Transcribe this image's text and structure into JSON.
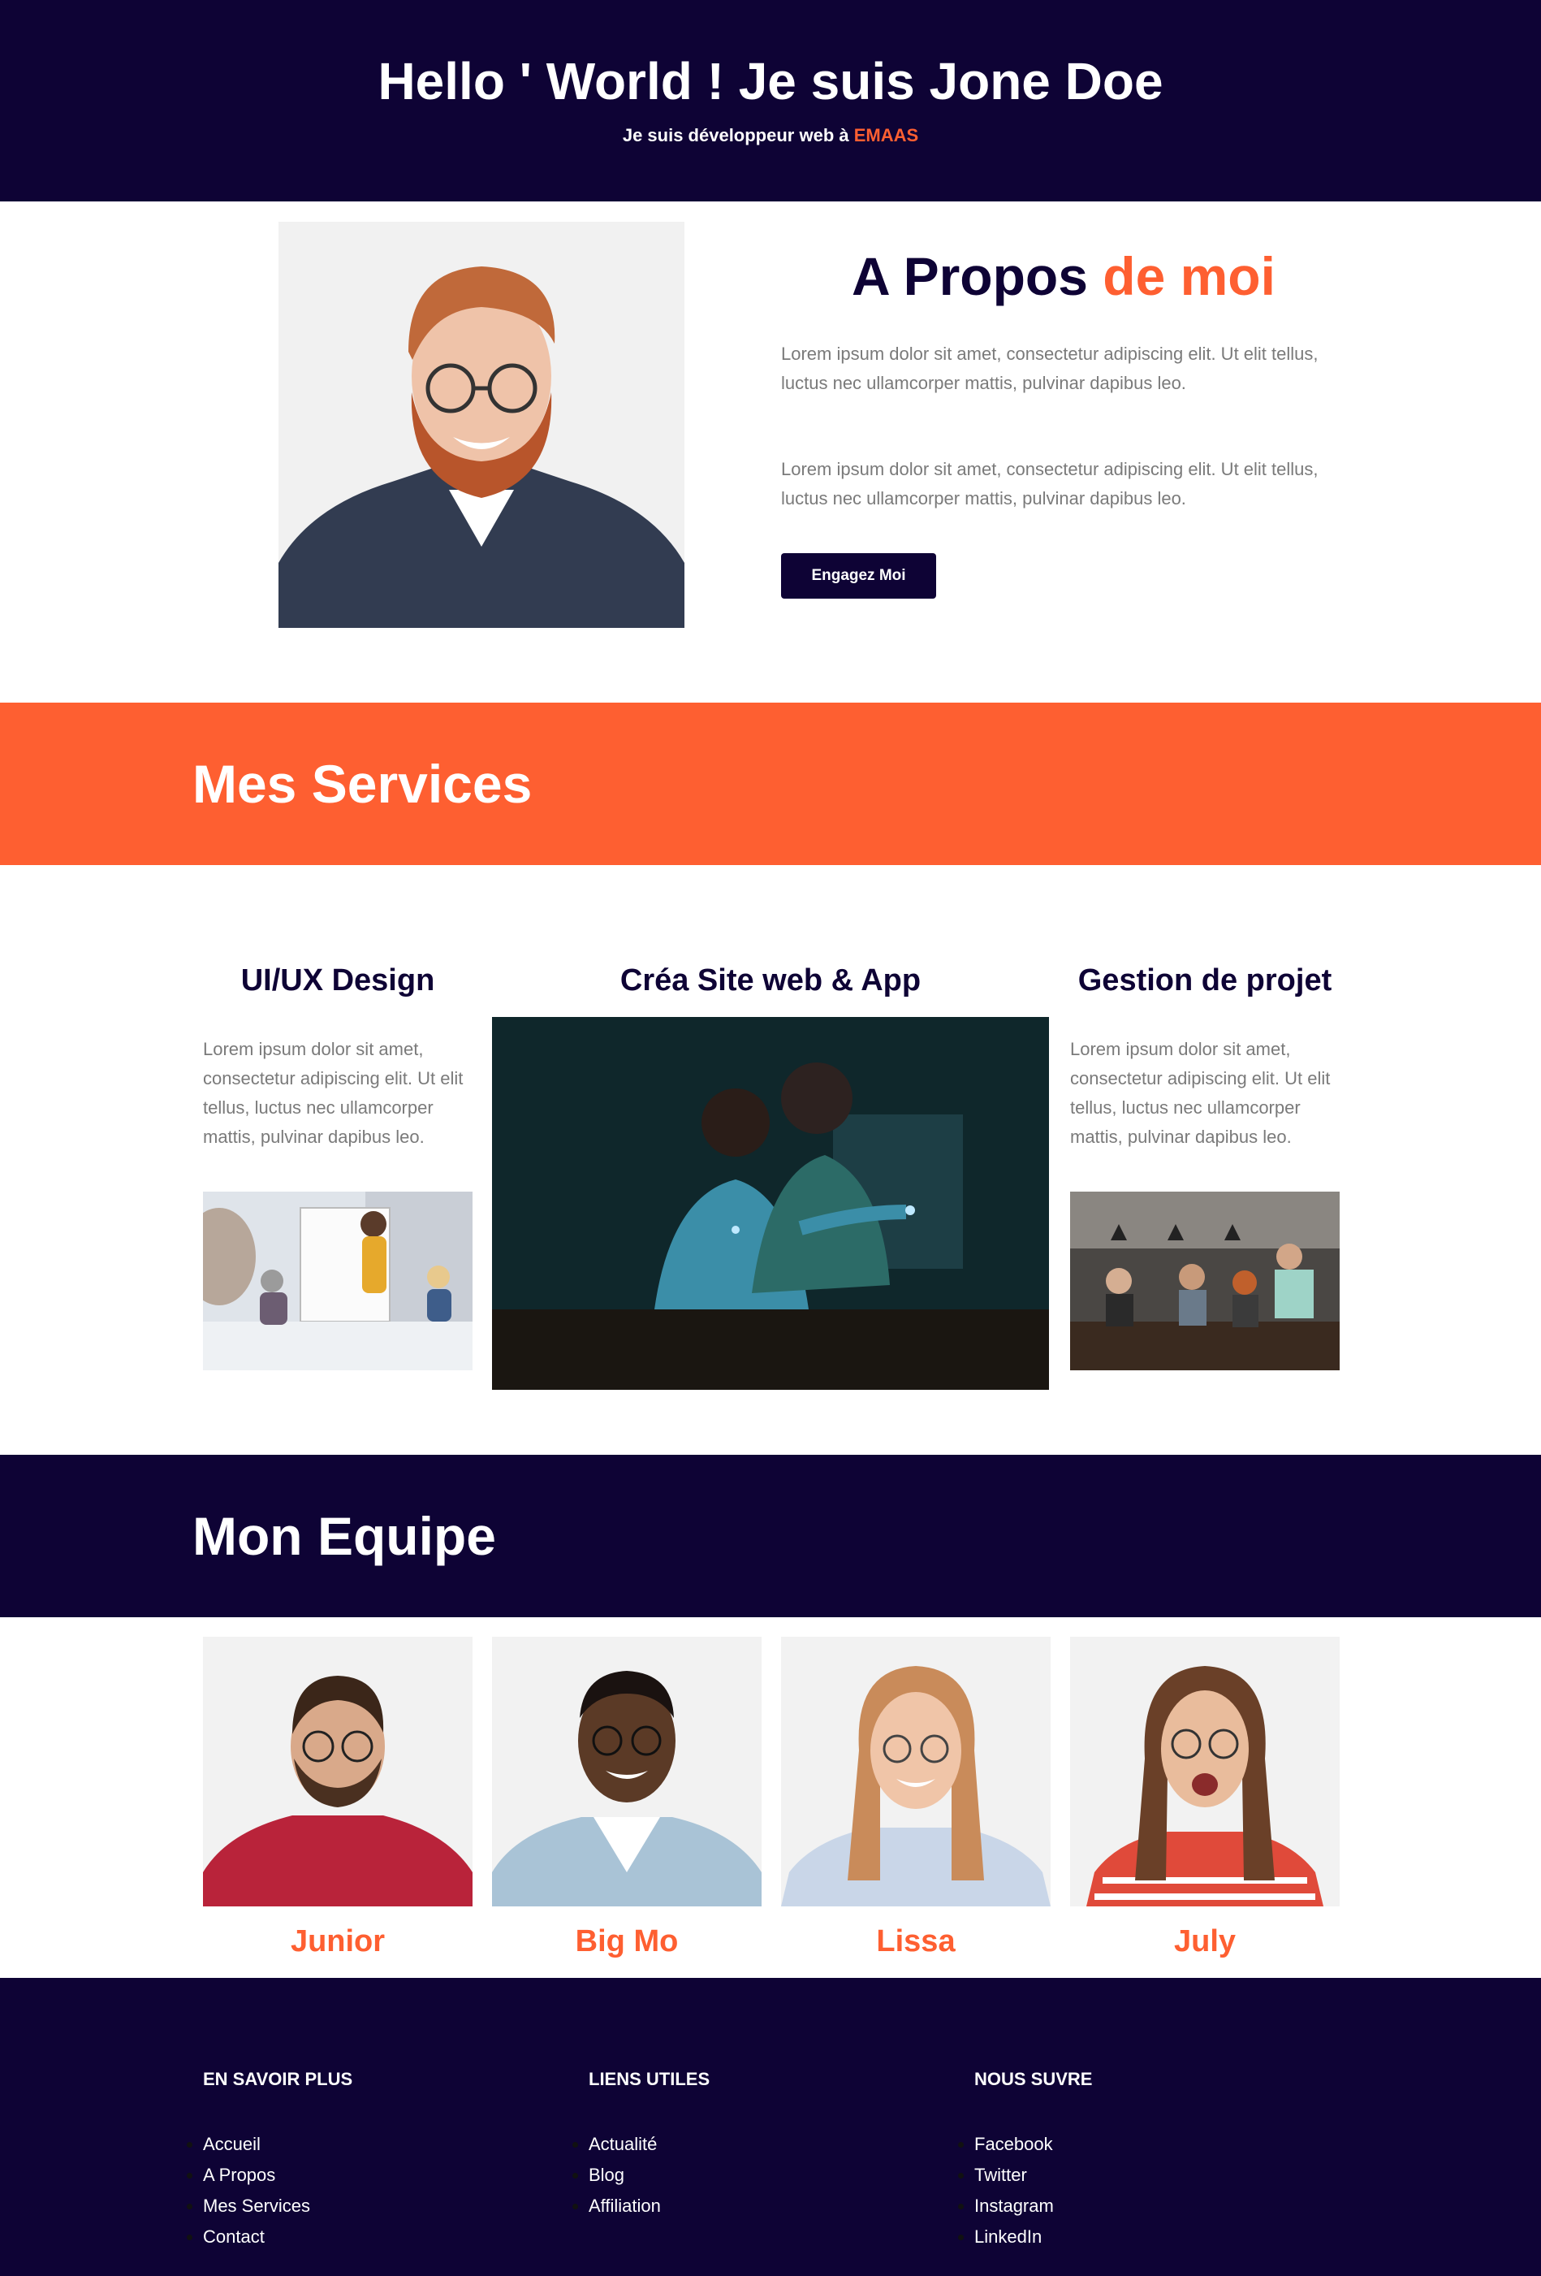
{
  "hero": {
    "title": "Hello ' World ! Je suis Jone Doe",
    "subtitle_prefix": "Je suis développeur web à ",
    "subtitle_highlight": "EMAAS"
  },
  "about": {
    "title_main": "A Propos ",
    "title_highlight": "de moi",
    "paragraph1": "Lorem ipsum dolor sit amet, consectetur adipiscing elit. Ut elit tellus, luctus nec ullamcorper mattis, pulvinar dapibus leo.",
    "paragraph2": "Lorem ipsum dolor sit amet, consectetur adipiscing elit. Ut elit tellus, luctus nec ullamcorper mattis, pulvinar dapibus leo.",
    "button_label": "Engagez Moi"
  },
  "services": {
    "heading": "Mes Services",
    "items": [
      {
        "title": "UI/UX Design",
        "text": "Lorem ipsum dolor sit amet, consectetur adipiscing elit. Ut elit tellus, luctus nec ullamcorper mattis, pulvinar dapibus leo."
      },
      {
        "title": "Créa Site web & App"
      },
      {
        "title": "Gestion de projet",
        "text": "Lorem ipsum dolor sit amet, consectetur adipiscing elit. Ut elit tellus, luctus nec ullamcorper mattis, pulvinar dapibus leo."
      }
    ]
  },
  "team": {
    "heading": "Mon Equipe",
    "members": [
      {
        "name": "Junior"
      },
      {
        "name": "Big Mo"
      },
      {
        "name": "Lissa"
      },
      {
        "name": "July"
      }
    ]
  },
  "footer": {
    "columns": [
      {
        "heading": "EN SAVOIR PLUS",
        "links": [
          "Accueil",
          "A Propos",
          "Mes Services",
          "Contact"
        ]
      },
      {
        "heading": "LIENS UTILES",
        "links": [
          "Actualité",
          "Blog",
          "Affiliation"
        ]
      },
      {
        "heading": "NOUS SUVRE",
        "links": [
          "Facebook",
          "Twitter",
          "Instagram",
          "LinkedIn"
        ]
      }
    ]
  },
  "colors": {
    "navy": "#0e0335",
    "accent": "#fe5f31",
    "body_text": "#7a7a7a"
  }
}
